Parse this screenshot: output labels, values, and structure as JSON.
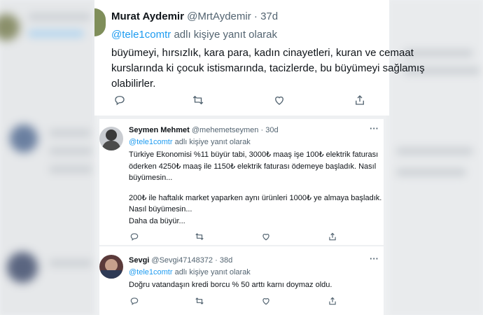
{
  "tweet_main": {
    "name": "Murat Aydemir",
    "handle": "@MrtAydemir",
    "sep": "·",
    "age": "37d",
    "reply_mention": "@tele1comtr",
    "reply_suffix": "adlı kişiye yanıt olarak",
    "text_lines": [
      "büyümeyi, hırsızlık, kara para, kadın cinayetleri, kuran ve cemaat",
      "kurslarında ki çocuk istismarında, tacizlerde, bu büyümeyi sağlamış",
      "olabilirler."
    ]
  },
  "tweet_2": {
    "name": "Seymen Mehmet",
    "handle": "@mehemetseymen",
    "sep": "·",
    "age": "30d",
    "more": "···",
    "reply_mention": "@tele1comtr",
    "reply_suffix": "adlı kişiye yanıt olarak",
    "text_lines": [
      "Türkiye Ekonomisi %11 büyür tabi, 3000₺ maaş işe 100₺ elektrik faturası",
      "öderken 4250₺ maaş ile 1150₺ elektrik faturası ödemeye başladık. Nasıl",
      "büyümesin...",
      "200₺ ile haftalık market yaparken aynı ürünleri 1000₺ ye almaya başladık.",
      "Nasıl büyümesin...",
      "Daha da büyür..."
    ]
  },
  "tweet_3": {
    "name": "Sevgi",
    "handle": "@Sevgi47148372",
    "sep": "·",
    "age": "38d",
    "more": "···",
    "reply_mention": "@tele1comtr",
    "reply_suffix": "adlı kişiye yanıt olarak",
    "text_lines": [
      "Doğru vatandaşın kredi borcu % 50 arttı karnı doymaz oldu."
    ]
  },
  "icons": [
    "reply-icon",
    "retweet-icon",
    "like-icon",
    "share-icon",
    "more-icon"
  ],
  "colors": {
    "link": "#1d9bf0",
    "muted": "#536471",
    "text": "#0f1419"
  }
}
